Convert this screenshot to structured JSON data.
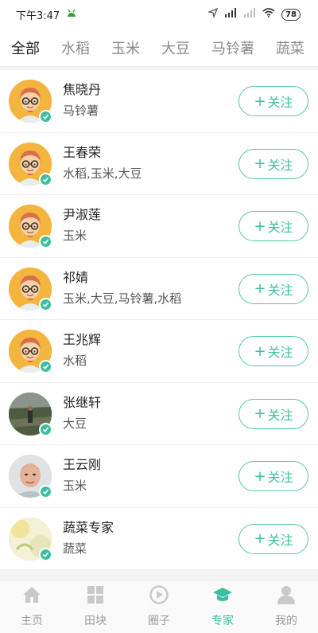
{
  "status_bar": {
    "time": "下午3:47",
    "battery": "78"
  },
  "tabs": [
    {
      "label": "全部",
      "active": true
    },
    {
      "label": "水稻",
      "active": false
    },
    {
      "label": "玉米",
      "active": false
    },
    {
      "label": "大豆",
      "active": false
    },
    {
      "label": "马铃薯",
      "active": false
    },
    {
      "label": "蔬菜",
      "active": false
    }
  ],
  "experts": [
    {
      "name": "焦晓丹",
      "crops": "马铃薯",
      "avatar": "cartoon"
    },
    {
      "name": "王春荣",
      "crops": "水稻,玉米,大豆",
      "avatar": "cartoon"
    },
    {
      "name": "尹淑莲",
      "crops": "玉米",
      "avatar": "cartoon"
    },
    {
      "name": "祁婧",
      "crops": "玉米,大豆,马铃薯,水稻",
      "avatar": "cartoon"
    },
    {
      "name": "王兆辉",
      "crops": "水稻",
      "avatar": "cartoon"
    },
    {
      "name": "张继轩",
      "crops": "大豆",
      "avatar": "field-photo"
    },
    {
      "name": "王云刚",
      "crops": "玉米",
      "avatar": "portrait-photo"
    },
    {
      "name": "蔬菜专家",
      "crops": "蔬菜",
      "avatar": "vegetable-photo"
    }
  ],
  "follow_label": "关注",
  "bottom_nav": [
    {
      "label": "主页",
      "icon": "home-icon",
      "active": false
    },
    {
      "label": "田块",
      "icon": "field-grid-icon",
      "active": false
    },
    {
      "label": "圈子",
      "icon": "play-circle-icon",
      "active": false
    },
    {
      "label": "专家",
      "icon": "graduation-cap-icon",
      "active": true
    },
    {
      "label": "我的",
      "icon": "user-icon",
      "active": false
    }
  ],
  "colors": {
    "accent": "#3bbfa0",
    "avatar_bg": "#f4b53f"
  }
}
